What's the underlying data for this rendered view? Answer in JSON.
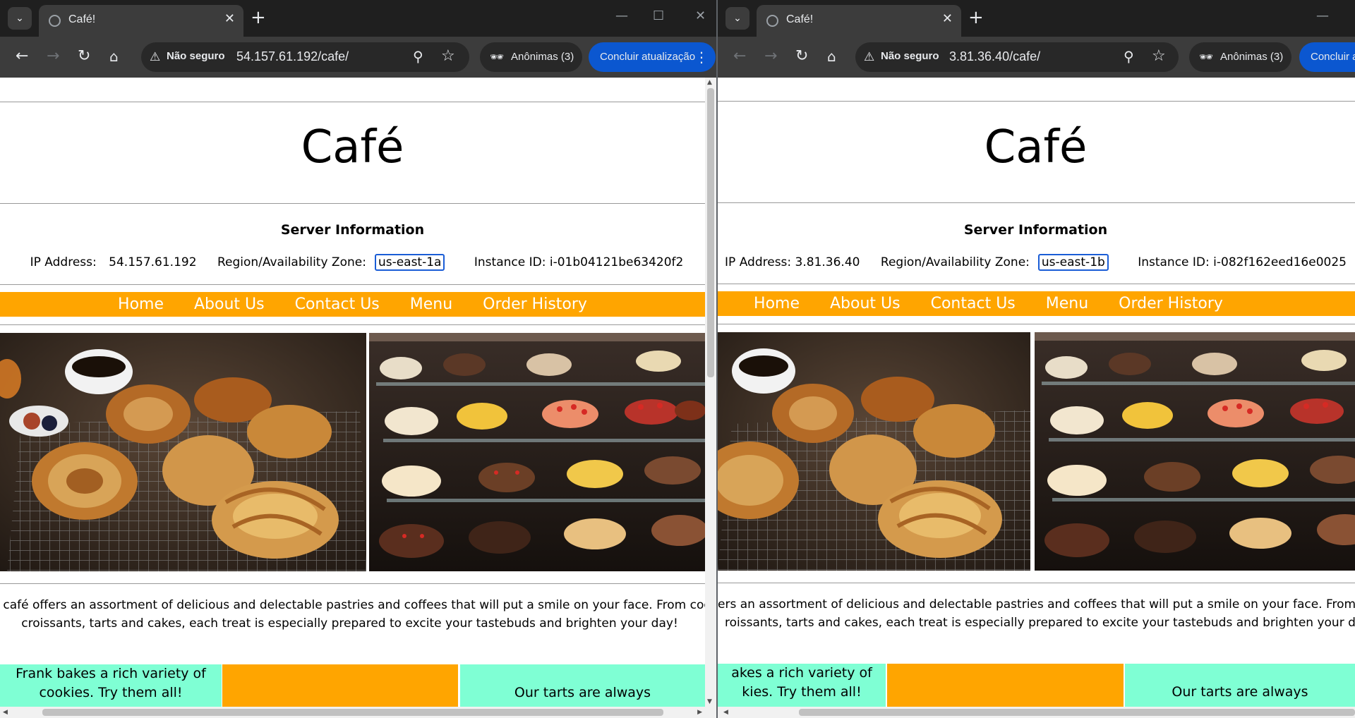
{
  "left": {
    "tab": {
      "title": "Café!"
    },
    "omnibox": {
      "security": "Não seguro",
      "url": "54.157.61.192/cafe/"
    },
    "incognito": {
      "label": "Anônimas (3)"
    },
    "update": {
      "label": "Concluir atualização"
    },
    "page": {
      "site_title": "Café",
      "server_heading": "Server Information",
      "ip_label": "IP Address:",
      "ip": "54.157.61.192",
      "az_label": "Region/Availability Zone:",
      "az": "us-east-1a",
      "instance_label": "Instance ID:",
      "instance_id": "i-01b04121be63420f2",
      "nav": [
        "Home",
        "About Us",
        "Contact Us",
        "Menu",
        "Order History"
      ],
      "description_line1": "r café offers an assortment of delicious and delectable pastries and coffees that will put a smile on your face. From cookie",
      "description_line2": "croissants, tarts and cakes, each treat is especially prepared to excite your tastebuds and brighten your day!",
      "card1_line1": "Frank bakes a rich variety of",
      "card1_line2": "cookies. Try them all!",
      "card3_line1": "Our tarts are always"
    }
  },
  "right": {
    "tab": {
      "title": "Café!"
    },
    "omnibox": {
      "security": "Não seguro",
      "url": "3.81.36.40/cafe/"
    },
    "incognito": {
      "label": "Anônimas (3)"
    },
    "update": {
      "label": "Concluir atualização"
    },
    "page": {
      "site_title": "Café",
      "server_heading": "Server Information",
      "ip_label": "IP Address:",
      "ip": "3.81.36.40",
      "az_label": "Region/Availability Zone:",
      "az": "us-east-1b",
      "instance_label": "Instance ID:",
      "instance_id": "i-082f162eed16e0025",
      "nav": [
        "Home",
        "About Us",
        "Contact Us",
        "Menu",
        "Order History"
      ],
      "description_line1": "ers an assortment of delicious and delectable pastries and coffees that will put a smile on your face. From coo",
      "description_line2": "roissants, tarts and cakes, each treat is especially prepared to excite your tastebuds and brighten your day!",
      "card1_line1": "akes a rich variety of",
      "card1_line2": "kies. Try them all!",
      "card3_line1": "Our tarts are always"
    }
  },
  "colors": {
    "nav_bar": "#ffa500",
    "card_teal": "#7fffd4",
    "az_highlight": "#1a5dd6",
    "update_button": "#0b57d0"
  },
  "icons": [
    "tab-search-icon",
    "globe-favicon-icon",
    "close-icon",
    "plus-icon",
    "back-arrow-icon",
    "forward-arrow-icon",
    "reload-icon",
    "home-icon",
    "warning-icon",
    "zoom-icon",
    "star-icon",
    "incognito-icon",
    "more-vert-icon",
    "minimize-icon",
    "maximize-icon"
  ]
}
